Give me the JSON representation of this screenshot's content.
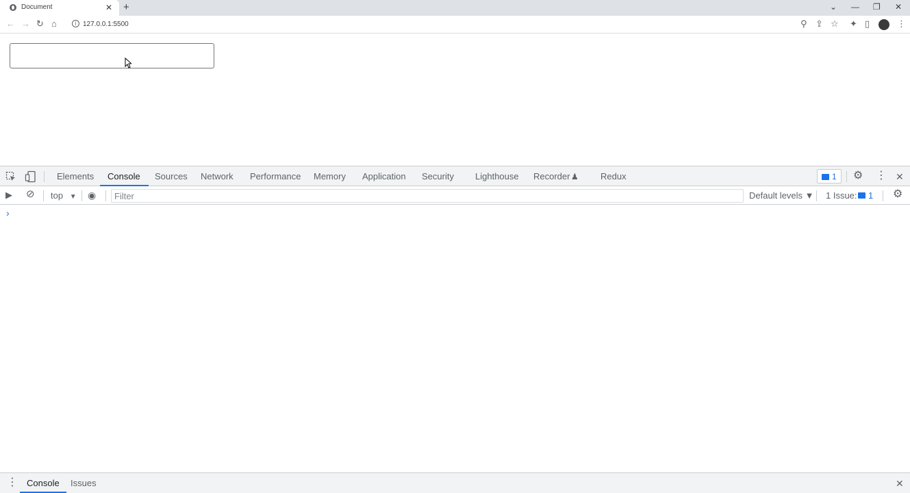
{
  "browser": {
    "tab": {
      "title": "Document",
      "close": "✕"
    },
    "new_tab": "+",
    "window_controls": {
      "tabsearch": "⌄",
      "minimize": "—",
      "restore": "❐",
      "close": "✕"
    },
    "toolbar": {
      "back": "←",
      "forward": "→",
      "reload": "↻",
      "home": "⌂",
      "info": "i"
    },
    "url": "127.0.0.1:5500",
    "toolbar_icons": {
      "zoom": "⚲",
      "share": "⇪",
      "bookmark": "☆",
      "extensions": "✦",
      "sidepanel": "▯",
      "menu": "⋮"
    }
  },
  "page": {
    "text_input_value": ""
  },
  "devtools": {
    "tabs": [
      {
        "label": "Elements"
      },
      {
        "label": "Console"
      },
      {
        "label": "Sources"
      },
      {
        "label": "Network"
      },
      {
        "label": "Performance"
      },
      {
        "label": "Memory"
      },
      {
        "label": "Application"
      },
      {
        "label": "Security"
      },
      {
        "label": "Lighthouse"
      },
      {
        "label": "Recorder"
      },
      {
        "label": "Redux"
      }
    ],
    "active_tab": "Console",
    "recorder_flask": "♟",
    "message_count": "1",
    "icons": {
      "settings": "⚙",
      "more": "⋮",
      "close": "✕",
      "inspect": "⬚",
      "device": "▭"
    },
    "console": {
      "context": "top",
      "context_arrow": "▼",
      "filter_placeholder": "Filter",
      "levels": "Default levels ▼",
      "issues_label": "1 Issue:",
      "issues_count": "1",
      "prompt": "›",
      "sidebar_icon": "▶",
      "clear_icon": "⊘",
      "eye_icon": "◉",
      "settings_icon": "⚙"
    },
    "drawer": {
      "menu": "⋮",
      "tabs": [
        {
          "label": "Console"
        },
        {
          "label": "Issues"
        }
      ],
      "close": "✕"
    }
  }
}
